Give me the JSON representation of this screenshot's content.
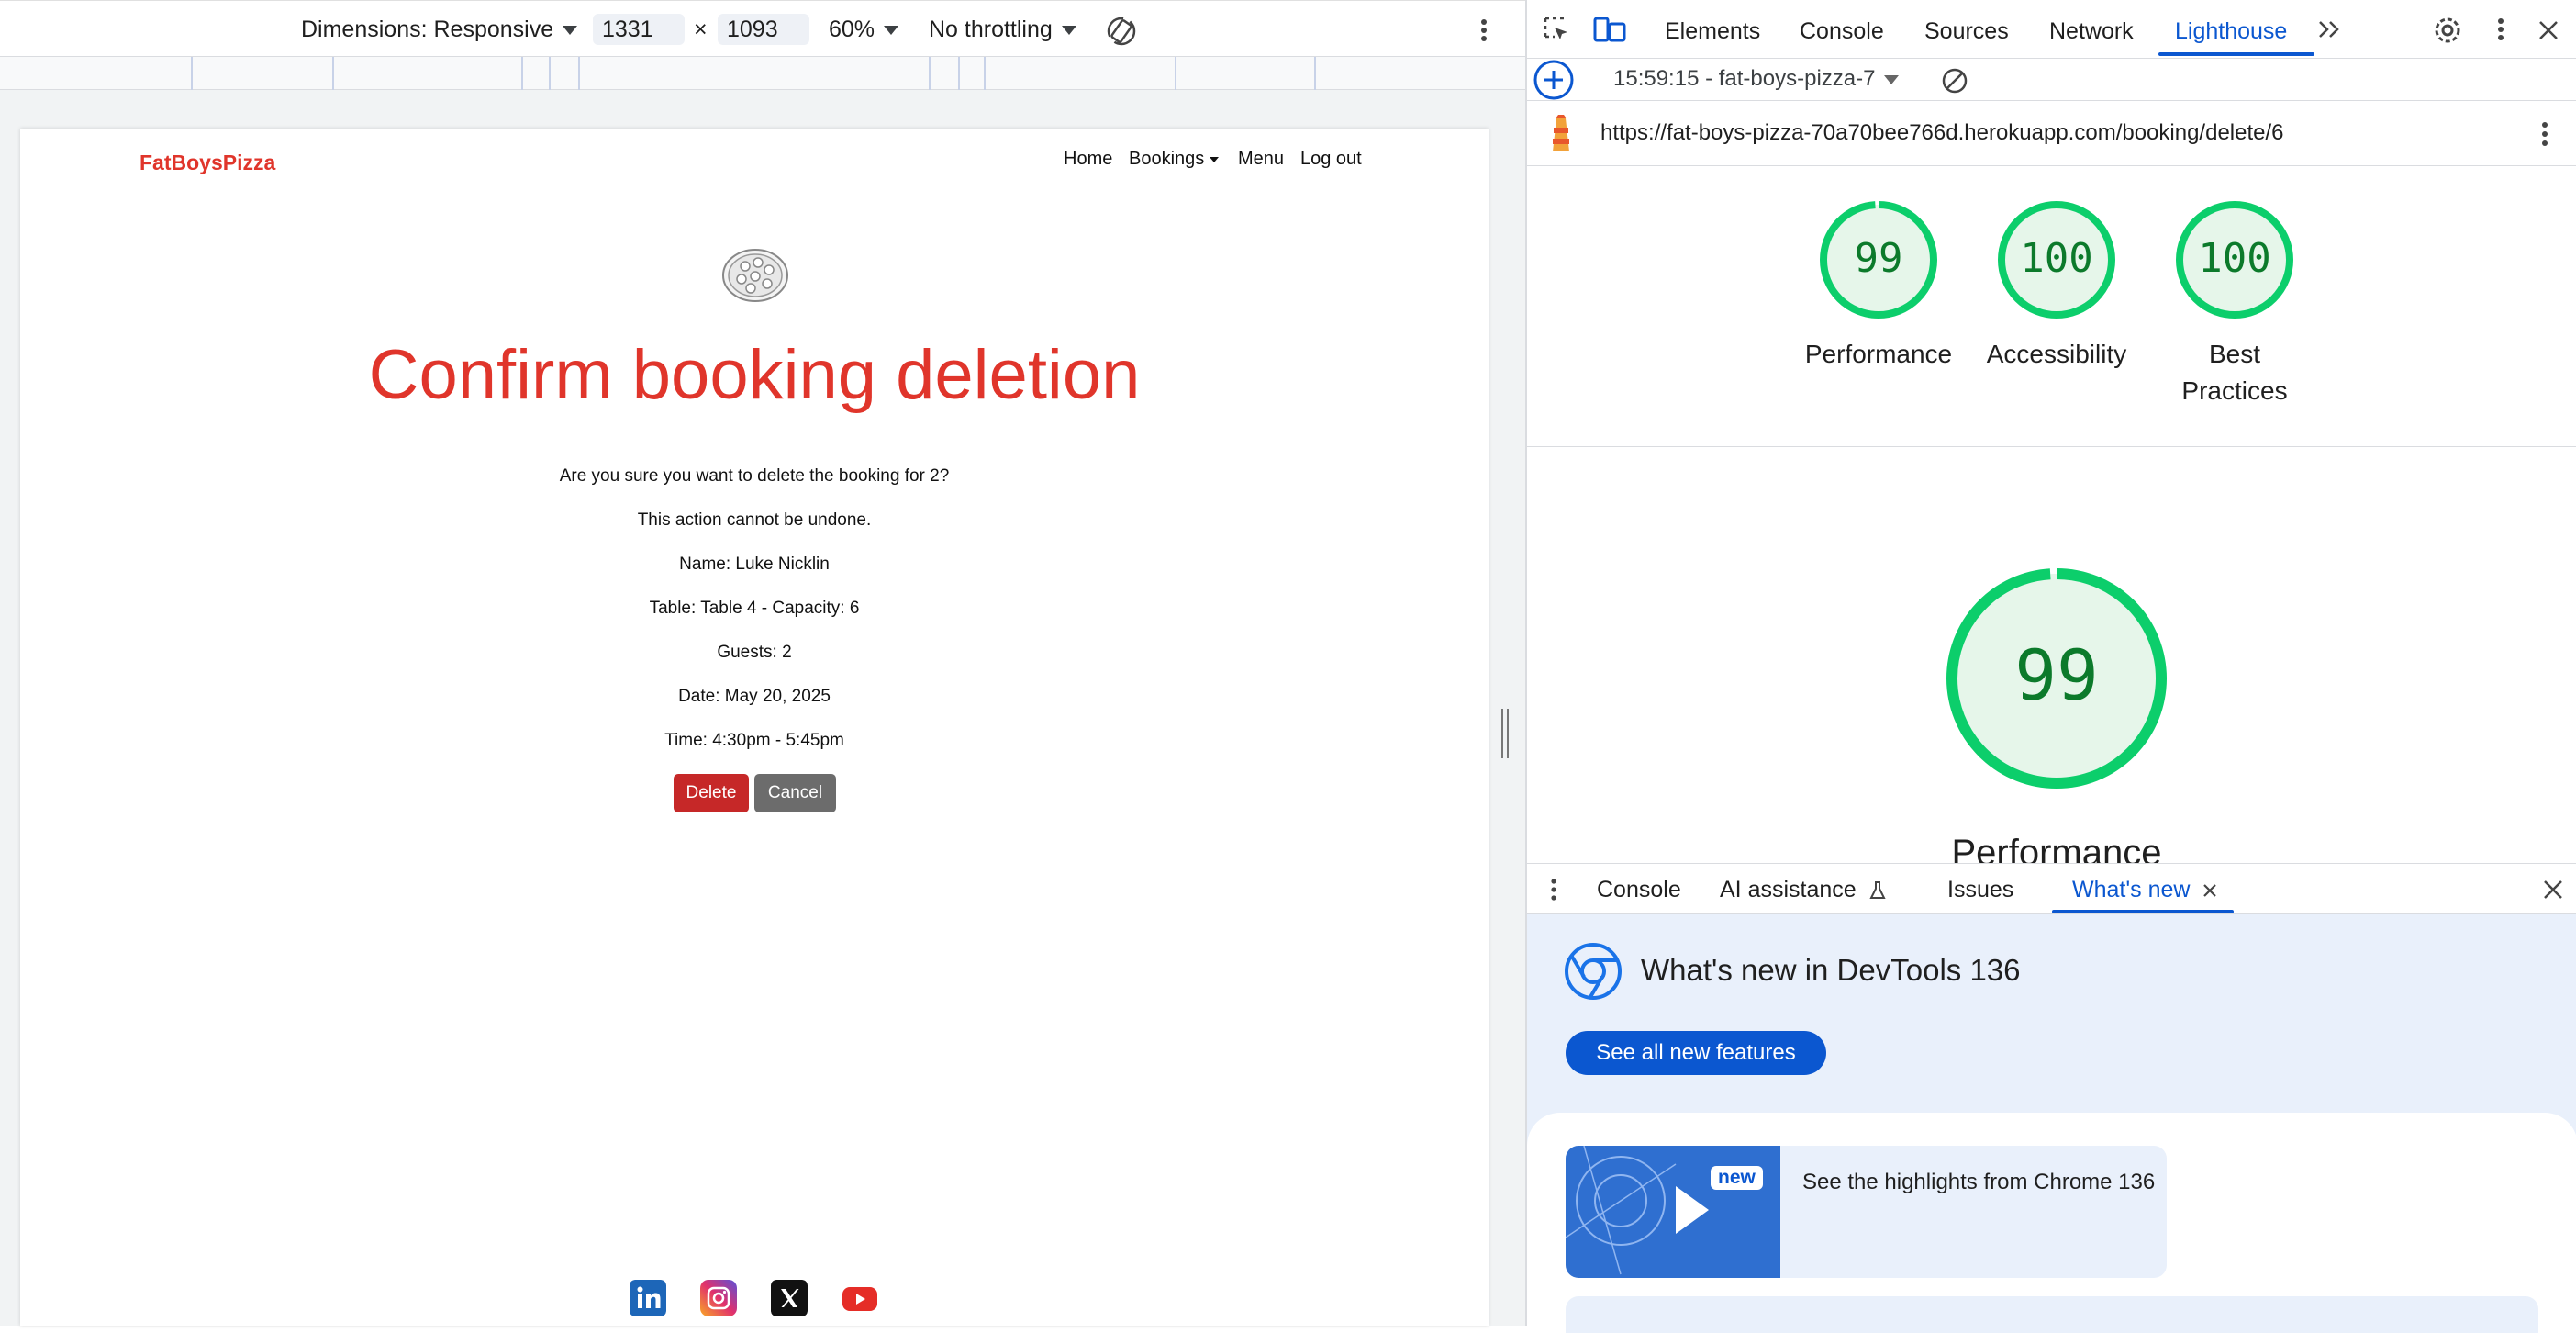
{
  "device_toolbar": {
    "dimensions_label": "Dimensions: Responsive",
    "width": "1331",
    "times": "×",
    "height": "1093",
    "zoom": "60%",
    "throttling": "No throttling"
  },
  "site": {
    "brand": "FatBoysPizza",
    "nav": {
      "home": "Home",
      "bookings": "Bookings",
      "menu": "Menu",
      "logout": "Log out"
    },
    "title": "Confirm booking deletion",
    "question": "Are you sure you want to delete the booking for 2?",
    "warning": "This action cannot be undone.",
    "name": "Name: Luke Nicklin",
    "table": "Table: Table 4 - Capacity: 6",
    "guests": "Guests: 2",
    "date": "Date: May 20, 2025",
    "time": "Time: 4:30pm - 5:45pm",
    "delete_label": "Delete",
    "cancel_label": "Cancel"
  },
  "devtools": {
    "tabs": [
      "Elements",
      "Console",
      "Sources",
      "Network",
      "Lighthouse"
    ],
    "active_tab": "Lighthouse",
    "report_label": "15:59:15 - fat-boys-pizza-7",
    "url": "https://fat-boys-pizza-70a70bee766d.herokuapp.com/booking/delete/6",
    "scores": [
      {
        "value": "99",
        "label": "Performance",
        "fraction": 0.99
      },
      {
        "value": "100",
        "label": "Accessibility",
        "fraction": 1.0
      },
      {
        "value": "100",
        "label": "Best Practices",
        "fraction": 1.0
      }
    ],
    "big_score": {
      "value": "99",
      "label": "Performance",
      "fraction": 0.99
    },
    "score_color": "#0cce6b",
    "accent_color": "#0b57d0"
  },
  "drawer": {
    "tabs": [
      "Console",
      "AI assistance",
      "Issues",
      "What's new"
    ],
    "active_tab": "What's new",
    "whats_new_title": "What's new in DevTools 136",
    "see_all_label": "See all new features",
    "badge": "new",
    "highlight_text": "See the highlights from Chrome 136"
  }
}
